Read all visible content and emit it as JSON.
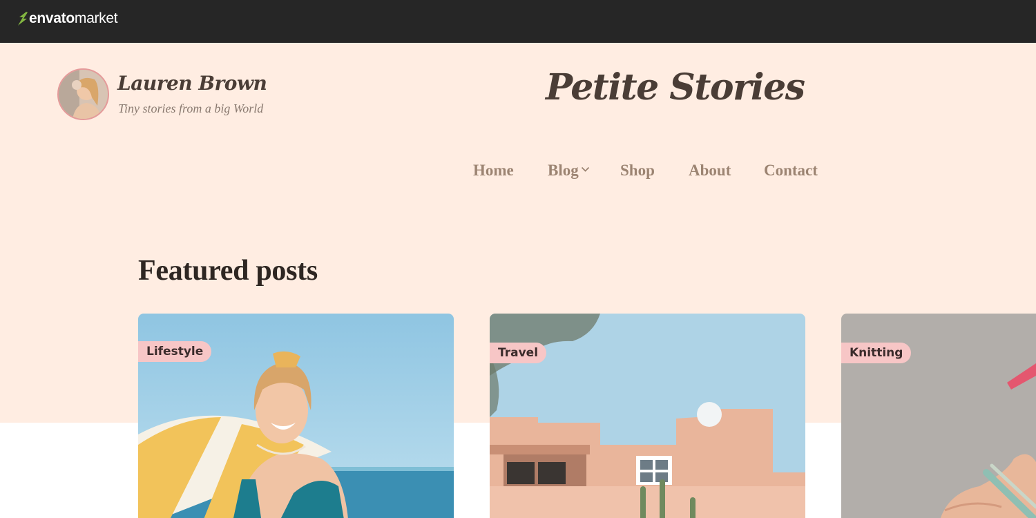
{
  "envato": {
    "brand_bold": "envato",
    "brand_light": "market",
    "accent_color": "#82b541"
  },
  "header": {
    "author_name": "Lauren Brown",
    "author_tagline": "Tiny stories from a big World",
    "site_title": "Petite Stories",
    "background_color": "#ffede2"
  },
  "nav": {
    "items": [
      {
        "label": "Home"
      },
      {
        "label": "Blog",
        "has_dropdown": true
      },
      {
        "label": "Shop"
      },
      {
        "label": "About"
      },
      {
        "label": "Contact"
      }
    ]
  },
  "featured": {
    "title": "Featured posts",
    "posts": [
      {
        "category": "Lifestyle",
        "image": "smiling-woman-beach-photo"
      },
      {
        "category": "Travel",
        "image": "adobe-house-sky-photo"
      },
      {
        "category": "Knitting",
        "image": "knitting-hands-photo"
      }
    ]
  }
}
